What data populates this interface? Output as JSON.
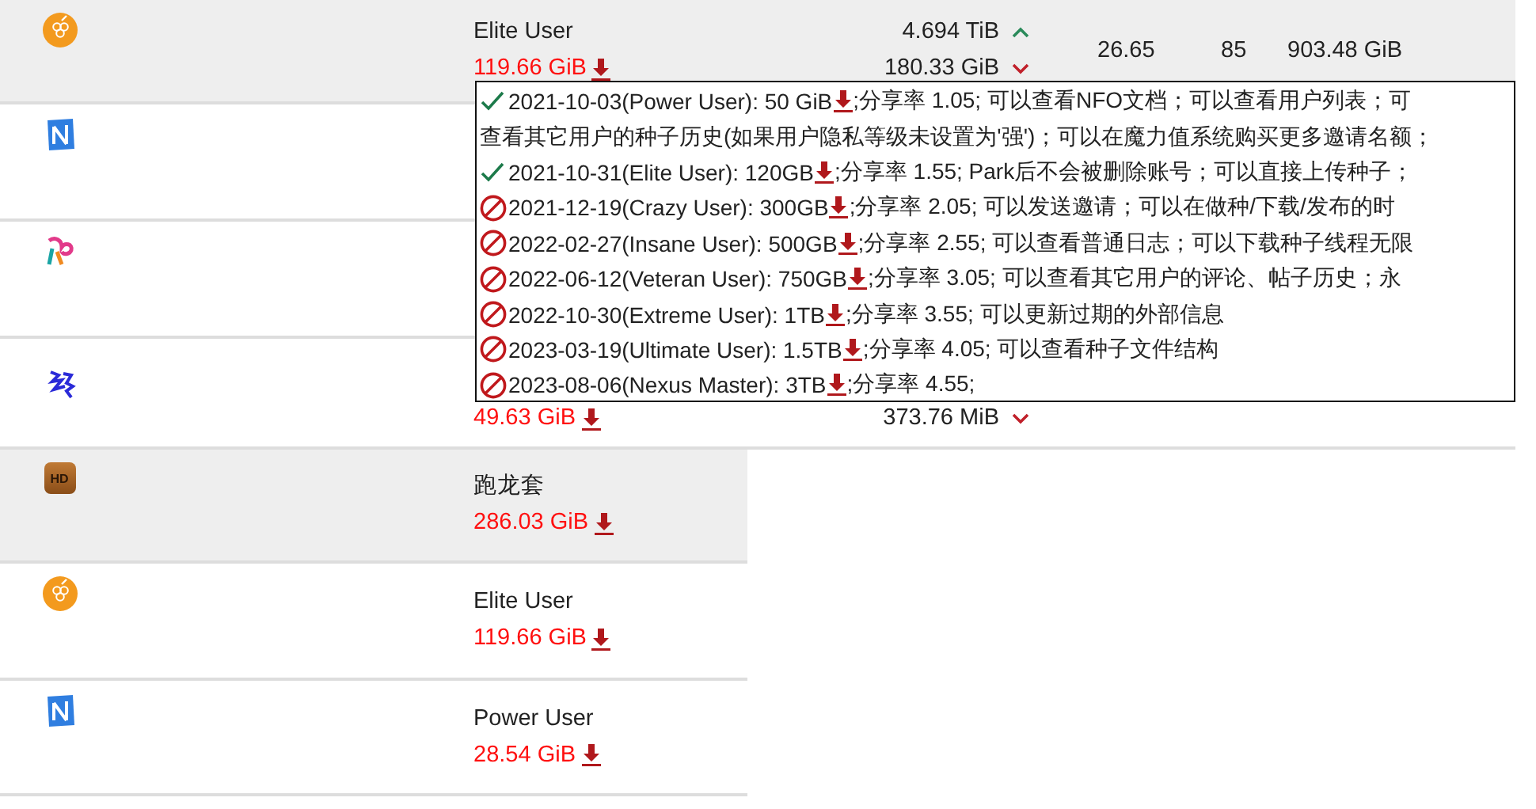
{
  "sites": [
    {
      "kind": "grape",
      "highlighted": true,
      "level": "Elite User",
      "level_size": "119.66 GiB",
      "upload": "4.694 TiB",
      "download": "180.33 GiB",
      "ratio": "26.65",
      "seeding": "85",
      "seeding_size": "903.48 GiB"
    },
    {
      "kind": "tile",
      "highlighted": false
    },
    {
      "kind": "rabbit",
      "highlighted": false
    },
    {
      "kind": "brush",
      "highlighted": false,
      "level_size": "49.63 GiB",
      "download": "373.76 MiB"
    },
    {
      "kind": "hd",
      "icon_text": "HD",
      "highlighted": true,
      "level": "跑龙套",
      "level_size": "286.03 GiB"
    },
    {
      "kind": "grape",
      "highlighted": false,
      "level": "Elite User",
      "level_size": "119.66 GiB"
    },
    {
      "kind": "tile",
      "highlighted": false,
      "level": "Power User",
      "level_size": "28.54 GiB"
    }
  ],
  "tooltip": {
    "lines": [
      {
        "kind": "achieved",
        "text": "2021-10-03(Power User): 50 GiB",
        "rest": ";分享率 1.05; 可以查看NFO文档；可以查看用户列表；可"
      },
      {
        "kind": "wrap",
        "text": "查看其它用户的种子历史(如果用户隐私等级未设置为'强')；可以在魔力值系统购买更多邀请名额；"
      },
      {
        "kind": "achieved",
        "text": "2021-10-31(Elite User): 120GB",
        "rest": ";分享率 1.55; Park后不会被删除账号；可以直接上传种子；"
      },
      {
        "kind": "locked",
        "text": "2021-12-19(Crazy User): 300GB",
        "rest": ";分享率 2.05; 可以发送邀请；可以在做种/下载/发布的时"
      },
      {
        "kind": "locked",
        "text": "2022-02-27(Insane User): 500GB",
        "rest": ";分享率 2.55; 可以查看普通日志；可以下载种子线程无限"
      },
      {
        "kind": "locked",
        "text": "2022-06-12(Veteran User): 750GB",
        "rest": ";分享率 3.05; 可以查看其它用户的评论、帖子历史；永"
      },
      {
        "kind": "locked",
        "text": "2022-10-30(Extreme User): 1TB",
        "rest": ";分享率 3.55; 可以更新过期的外部信息"
      },
      {
        "kind": "locked",
        "text": "2023-03-19(Ultimate User): 1.5TB",
        "rest": ";分享率 4.05; 可以查看种子文件结构"
      },
      {
        "kind": "locked",
        "text": "2023-08-06(Nexus Master): 3TB",
        "rest": ";分享率 4.55;"
      }
    ]
  }
}
